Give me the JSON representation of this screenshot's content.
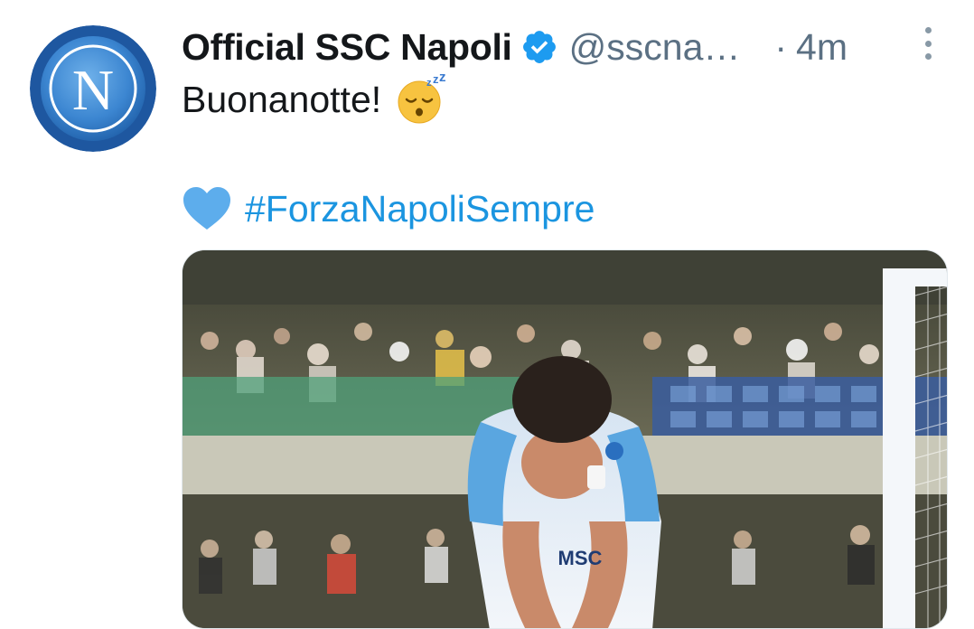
{
  "tweet": {
    "author": {
      "display_name": "Official SSC Napoli",
      "handle": "@sscna…",
      "verified": true,
      "avatar_letter": "N"
    },
    "separator": "·",
    "timestamp": "4m",
    "text_line1": "Buonanotte!",
    "hashtag": "#ForzaNapoliSempre",
    "emoji": [
      "sleeping-face",
      "blue-heart"
    ],
    "media": {
      "type": "photo",
      "shirt_sponsor": "MSC"
    }
  },
  "colors": {
    "name": "#14171a",
    "secondary": "#5b7083",
    "link": "#1b95e0",
    "verified_badge": "#1d9bf0",
    "napoli_blue": "#2a6fbf"
  },
  "icons": {
    "verified": "verified-badge-icon",
    "more": "more-options-icon"
  }
}
